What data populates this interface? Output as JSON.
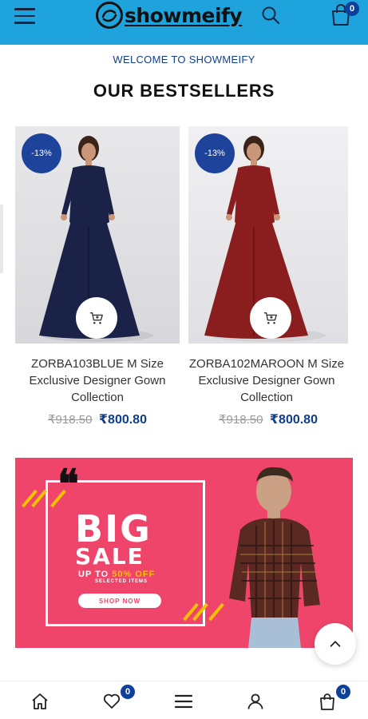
{
  "header": {
    "brand": "showmeify",
    "cart_count": "0",
    "background": "#1fa3dc"
  },
  "welcome": "WELCOME TO SHOWMEIFY",
  "section_title": "OUR BESTSELLERS",
  "products": [
    {
      "name": "ZORBA103BLUE M Size Exclusive Designer Gown Collection",
      "discount": "-13%",
      "old_price": "₹918.50",
      "new_price": "₹800.80",
      "dress_color": "#1a2347"
    },
    {
      "name": "ZORBA102MAROON M Size Exclusive Designer Gown Collection",
      "discount": "-13%",
      "old_price": "₹918.50",
      "new_price": "₹800.80",
      "dress_color": "#8a1e1e"
    }
  ],
  "banner": {
    "big": "BIG",
    "sale": "SALE",
    "upto_prefix": "UP TO ",
    "upto_highlight": "50% OFF",
    "selected": "SELECTED ITEMS",
    "button": "SHOP NOW",
    "background": "#f0456b"
  },
  "bottom_nav": {
    "items": [
      "home-icon",
      "heart-icon",
      "menu-icon",
      "user-icon",
      "cart-icon"
    ],
    "wishlist_count": "0",
    "cart_count": "0"
  }
}
